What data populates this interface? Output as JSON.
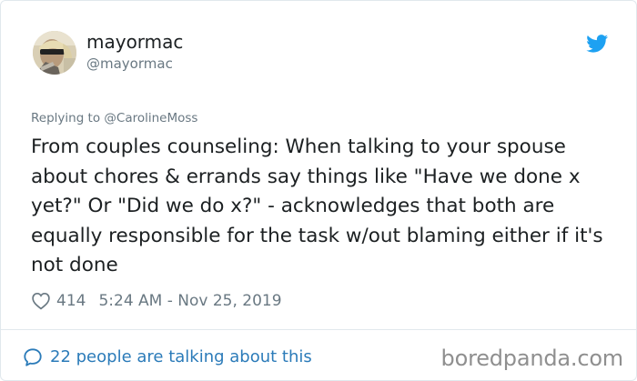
{
  "tweet": {
    "author_name": "mayormac",
    "author_handle": "@mayormac",
    "replying_to": "Replying to @CarolineMoss",
    "text": "From couples counseling: When talking to your spouse about chores & errands say things like \"Have we done x yet?\" Or \"Did we do x?\" - acknowledges that both are equally responsible for the task w/out blaming either if it's not done",
    "likes": "414",
    "timestamp": "5:24 AM - Nov 25, 2019",
    "conversation_label": "22 people are talking about this"
  },
  "watermark": "boredpanda.com",
  "icons": {
    "brand": "twitter-bird-icon",
    "like": "heart-icon",
    "conversation": "speech-bubble-icon",
    "avatar": "avatar-photo"
  },
  "colors": {
    "text": "#1c2022",
    "secondary": "#697882",
    "link": "#2b7bb9",
    "twitter_blue": "#1da1f2",
    "border": "#e1e8ed",
    "watermark": "#8f8f8f"
  }
}
